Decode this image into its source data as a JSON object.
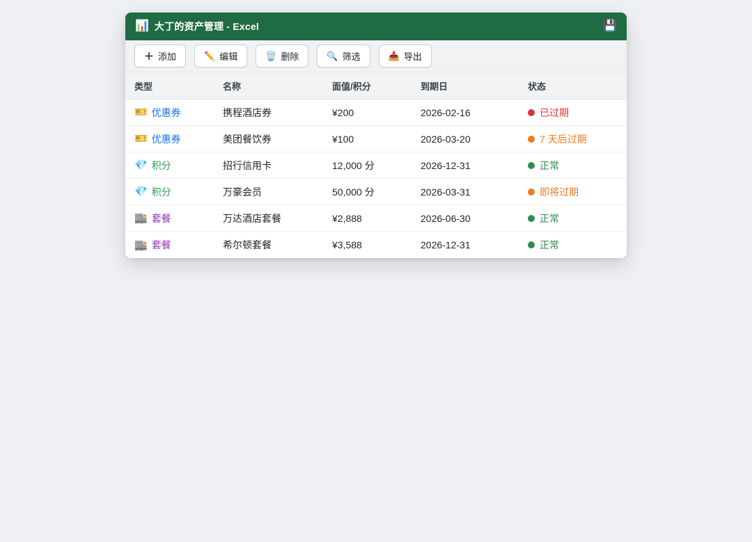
{
  "window": {
    "title": "大丁的资产管理 - Excel",
    "title_icon": "📊",
    "save_icon": "💾",
    "titlebar_color": "#1f6b43"
  },
  "toolbar": {
    "buttons": [
      {
        "icon": "＋",
        "label": "添加"
      },
      {
        "icon": "✏️",
        "label": "编辑"
      },
      {
        "icon": "🗑️",
        "label": "删除"
      },
      {
        "icon": "🔍",
        "label": "筛选"
      },
      {
        "icon": "📥",
        "label": "导出"
      }
    ]
  },
  "table": {
    "columns": [
      "类型",
      "名称",
      "面值/积分",
      "到期日",
      "状态"
    ],
    "rows": [
      {
        "type_icon": "🎫",
        "type": "优惠券",
        "type_color": "#1a73e8",
        "name": "携程酒店券",
        "value": "¥200",
        "expiry": "2026-02-16",
        "status": "已过期",
        "status_color": "#d93636"
      },
      {
        "type_icon": "🎫",
        "type": "优惠券",
        "type_color": "#1a73e8",
        "name": "美团餐饮券",
        "value": "¥100",
        "expiry": "2026-03-20",
        "status": "7 天后过期",
        "status_color": "#f5791f"
      },
      {
        "type_icon": "💎",
        "type": "积分",
        "type_color": "#2e9e52",
        "name": "招行信用卡",
        "value": "12,000 分",
        "expiry": "2026-12-31",
        "status": "正常",
        "status_color": "#2e8b4f"
      },
      {
        "type_icon": "💎",
        "type": "积分",
        "type_color": "#2e9e52",
        "name": "万豪会员",
        "value": "50,000 分",
        "expiry": "2026-03-31",
        "status": "即将过期",
        "status_color": "#f5791f"
      },
      {
        "type_icon": "🏬",
        "type": "套餐",
        "type_color": "#9333b8",
        "name": "万达酒店套餐",
        "value": "¥2,888",
        "expiry": "2026-06-30",
        "status": "正常",
        "status_color": "#2e8b4f"
      },
      {
        "type_icon": "🏬",
        "type": "套餐",
        "type_color": "#9333b8",
        "name": "希尔顿套餐",
        "value": "¥3,588",
        "expiry": "2026-12-31",
        "status": "正常",
        "status_color": "#2e8b4f"
      }
    ]
  }
}
